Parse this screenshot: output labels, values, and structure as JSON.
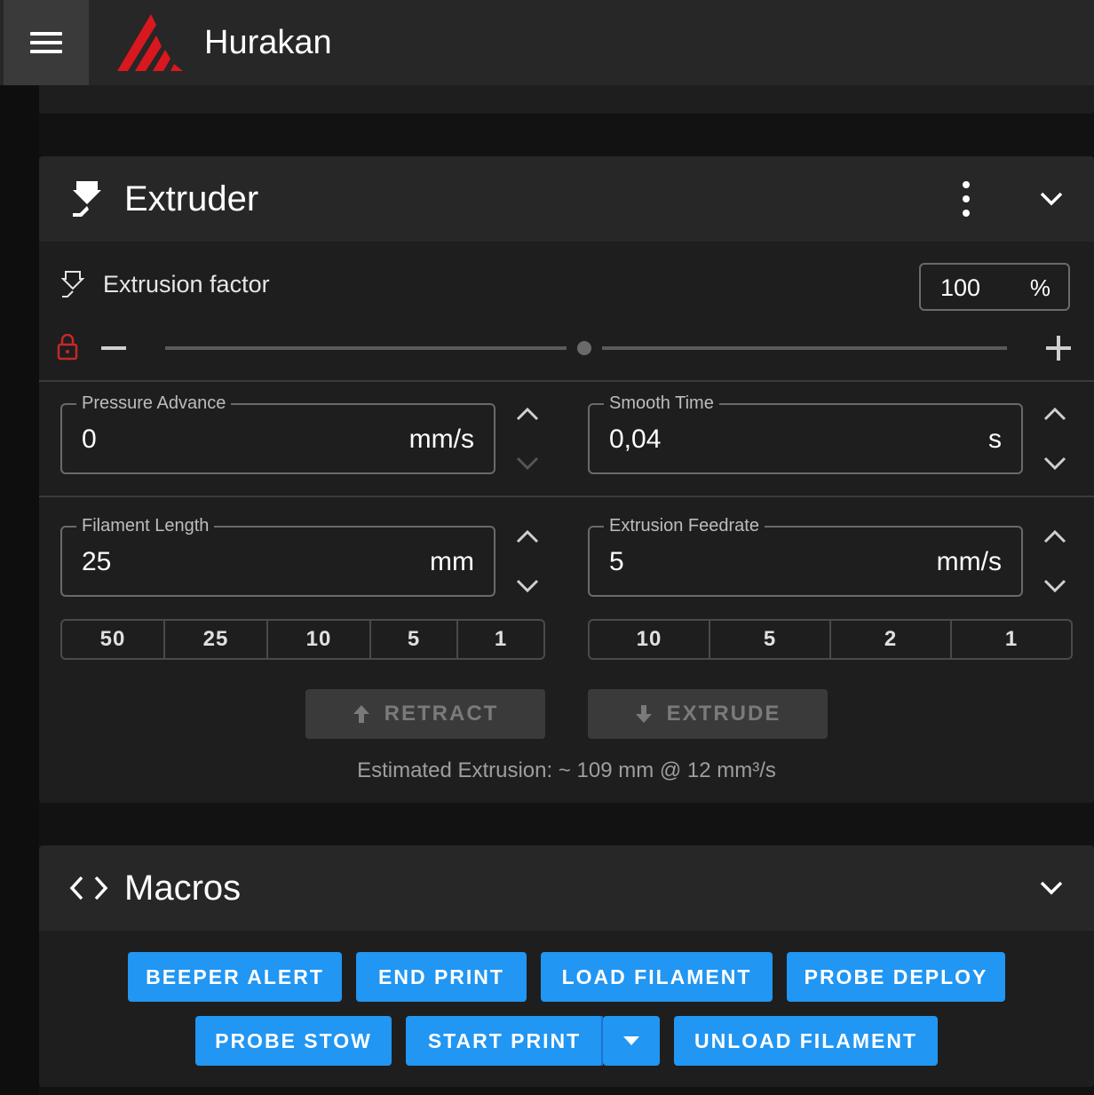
{
  "app": {
    "title": "Hurakan",
    "brand_color": "#d8181e"
  },
  "extruder": {
    "title": "Extruder",
    "extrusion_factor": {
      "label": "Extrusion factor",
      "value": "100",
      "unit": "%",
      "level": 100
    },
    "pressure_advance": {
      "label": "Pressure Advance",
      "value": "0",
      "unit": "mm/s"
    },
    "smooth_time": {
      "label": "Smooth Time",
      "value": "0,04",
      "unit": "s"
    },
    "filament_length": {
      "label": "Filament Length",
      "value": "25",
      "unit": "mm",
      "presets": [
        "50",
        "25",
        "10",
        "5",
        "1"
      ]
    },
    "extrusion_feedrate": {
      "label": "Extrusion Feedrate",
      "value": "5",
      "unit": "mm/s",
      "presets": [
        "10",
        "5",
        "2",
        "1"
      ]
    },
    "retract_label": "RETRACT",
    "extrude_label": "EXTRUDE",
    "estimate": "Estimated Extrusion: ~ 109 mm @ 12 mm³/s"
  },
  "macros": {
    "title": "Macros",
    "buttons": [
      "BEEPER ALERT",
      "END PRINT",
      "LOAD FILAMENT",
      "PROBE DEPLOY",
      "PROBE STOW",
      "START PRINT",
      "UNLOAD FILAMENT"
    ],
    "accent": "#2196f3"
  }
}
